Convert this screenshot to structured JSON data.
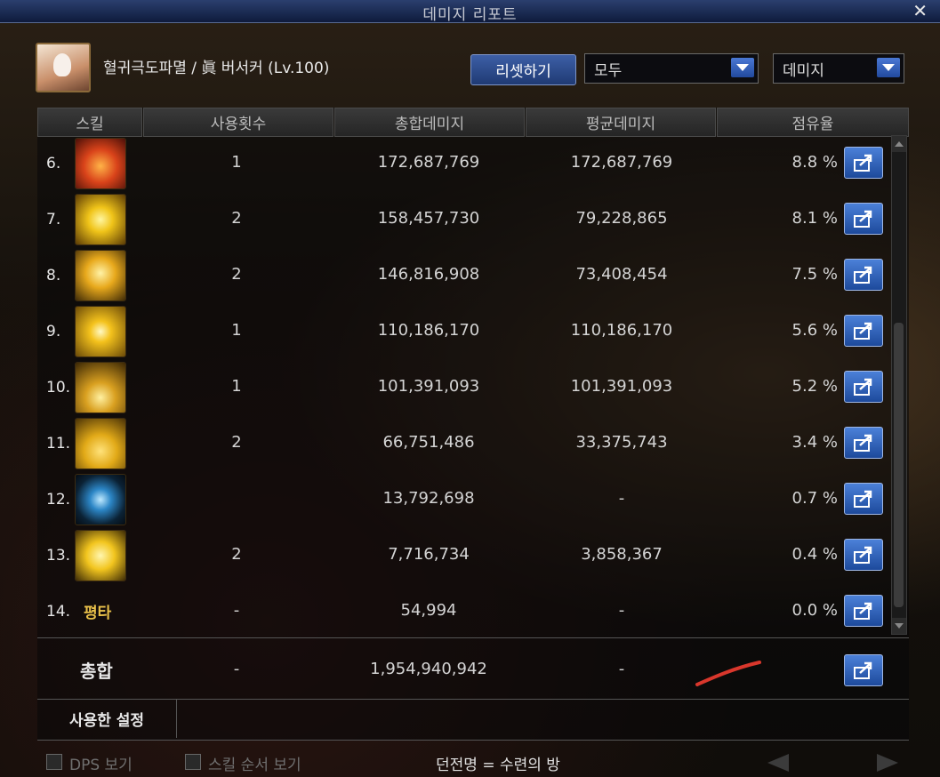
{
  "window": {
    "title": "데미지 리포트",
    "close_label": "✕"
  },
  "header": {
    "character": "혈귀극도파멸 / 眞 버서커 (Lv.100)",
    "reset_label": "리셋하기",
    "filter_select": "모두",
    "metric_select": "데미지"
  },
  "columns": [
    "스킬",
    "사용횟수",
    "총합데미지",
    "평균데미지",
    "점유율"
  ],
  "rows": [
    {
      "num": "6.",
      "icon": "flame-beast-icon",
      "uses": "1",
      "total": "172,687,769",
      "avg": "172,687,769",
      "share": "8.8 %"
    },
    {
      "num": "7.",
      "icon": "burst-icon",
      "uses": "2",
      "total": "158,457,730",
      "avg": "79,228,865",
      "share": "8.1 %"
    },
    {
      "num": "8.",
      "icon": "explosion-icon",
      "uses": "2",
      "total": "146,816,908",
      "avg": "73,408,454",
      "share": "7.5 %"
    },
    {
      "num": "9.",
      "icon": "star-burst-icon",
      "uses": "1",
      "total": "110,186,170",
      "avg": "110,186,170",
      "share": "5.6 %"
    },
    {
      "num": "10.",
      "icon": "blood-fountain-icon",
      "uses": "1",
      "total": "101,391,093",
      "avg": "101,391,093",
      "share": "5.2 %"
    },
    {
      "num": "11.",
      "icon": "blood-wave-icon",
      "uses": "2",
      "total": "66,751,486",
      "avg": "33,375,743",
      "share": "3.4 %"
    },
    {
      "num": "12.",
      "icon": "eye-icon",
      "uses": "",
      "total": "13,792,698",
      "avg": "-",
      "share": "0.7 %"
    },
    {
      "num": "13.",
      "icon": "blood-drop-icon",
      "uses": "2",
      "total": "7,716,734",
      "avg": "3,858,367",
      "share": "0.4 %"
    },
    {
      "num": "14.",
      "label": "평타",
      "uses": "-",
      "total": "54,994",
      "avg": "-",
      "share": "0.0 %"
    }
  ],
  "total": {
    "label": "총합",
    "uses": "-",
    "total": "1,954,940,942",
    "avg": "-"
  },
  "settings_tab": "사용한 설정",
  "footer": {
    "dps_label": "DPS 보기",
    "skill_order_label": "스킬 순서 보기",
    "dungeon": "던전명 = 수련의 방"
  },
  "colors": {
    "accent": "#2f5db5",
    "highlight": "#e9c14a",
    "annotation": "#d9372c"
  }
}
